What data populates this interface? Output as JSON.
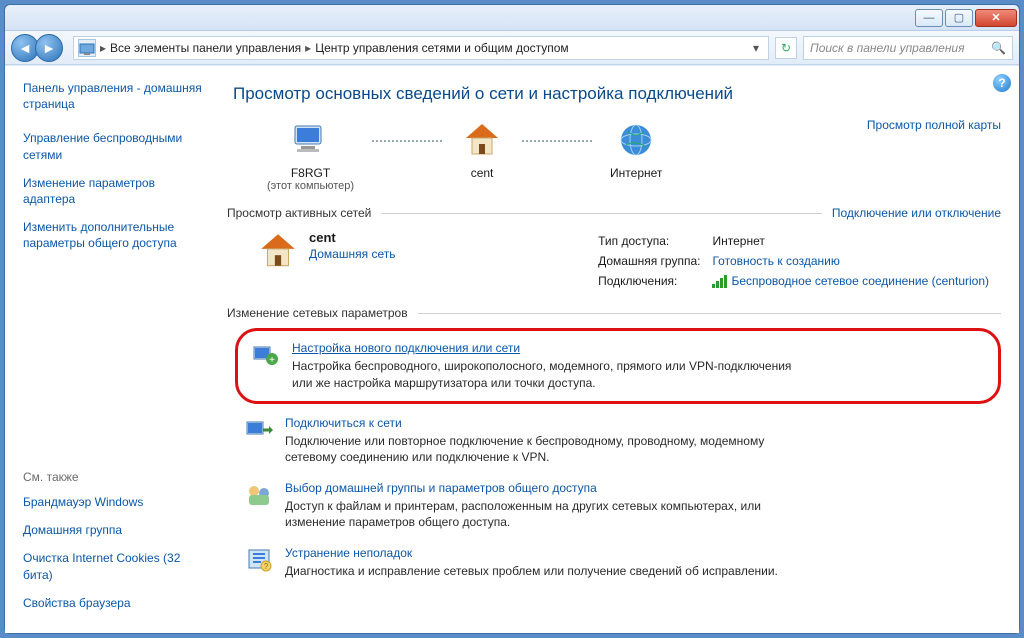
{
  "titlebar": {
    "min": "—",
    "max": "▢",
    "close": "✕"
  },
  "breadcrumb": {
    "root": "Все элементы панели управления",
    "current": "Центр управления сетями и общим доступом"
  },
  "search_placeholder": "Поиск в панели управления",
  "sidebar": {
    "home": "Панель управления - домашняя страница",
    "items": [
      "Управление беспроводными сетями",
      "Изменение параметров адаптера",
      "Изменить дополнительные параметры общего доступа"
    ],
    "see_also_title": "См. также",
    "see_also": [
      "Брандмауэр Windows",
      "Домашняя группа",
      "Очистка Internet Cookies (32 бита)",
      "Свойства браузера"
    ]
  },
  "main": {
    "heading": "Просмотр основных сведений о сети и настройка подключений",
    "map": {
      "node1": "F8RGT",
      "node1_sub": "(этот компьютер)",
      "node2": "cent",
      "node3": "Интернет",
      "full_map": "Просмотр полной карты"
    },
    "active_head": "Просмотр активных сетей",
    "connect_link": "Подключение или отключение",
    "active": {
      "name": "cent",
      "type": "Домашняя сеть",
      "r1k": "Тип доступа:",
      "r1v": "Интернет",
      "r2k": "Домашняя группа:",
      "r2v": "Готовность к созданию",
      "r3k": "Подключения:",
      "r3v": "Беспроводное сетевое соединение (centurion)"
    },
    "change_head": "Изменение сетевых параметров",
    "settings": [
      {
        "title": "Настройка нового подключения или сети",
        "desc": "Настройка беспроводного, широкополосного, модемного, прямого или VPN-подключения или же настройка маршрутизатора или точки доступа."
      },
      {
        "title": "Подключиться к сети",
        "desc": "Подключение или повторное подключение к беспроводному, проводному, модемному сетевому соединению или подключение к VPN."
      },
      {
        "title": "Выбор домашней группы и параметров общего доступа",
        "desc": "Доступ к файлам и принтерам, расположенным на других сетевых компьютерах, или изменение параметров общего доступа."
      },
      {
        "title": "Устранение неполадок",
        "desc": "Диагностика и исправление сетевых проблем или получение сведений об исправлении."
      }
    ]
  }
}
